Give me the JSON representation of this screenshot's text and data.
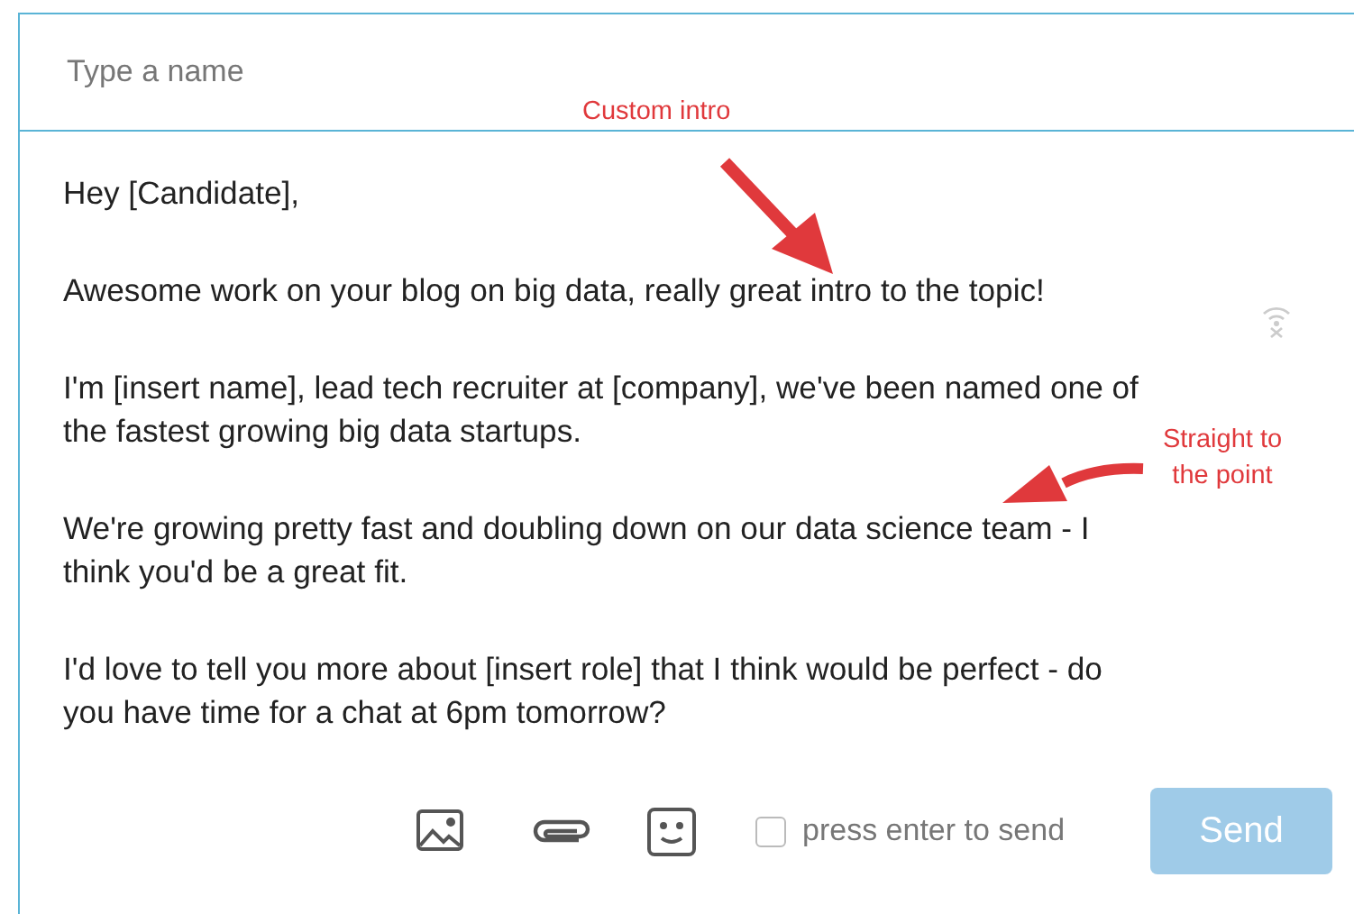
{
  "recipient": {
    "placeholder": "Type a name"
  },
  "message": [
    "Hey [Candidate],",
    "Awesome work on your blog on big data, really great intro to the topic!",
    "I'm [insert name], lead tech recruiter at [company], we've been named one of\nthe fastest growing big data startups.",
    "We're growing pretty fast and doubling down on our data science team - I\nthink you'd be a great fit.",
    "I'd love to tell you more about [insert role] that I think would be perfect - do\nyou have time for a chat at 6pm tomorrow?"
  ],
  "annotations": [
    {
      "text": "Custom intro",
      "kind": "straight"
    },
    {
      "text": "Straight to the point",
      "kind": "curved"
    }
  ],
  "toolbar": {
    "enter_to_send": {
      "label": "press enter to send",
      "checked": false
    },
    "send": {
      "label": "Send",
      "disabled": true
    }
  }
}
